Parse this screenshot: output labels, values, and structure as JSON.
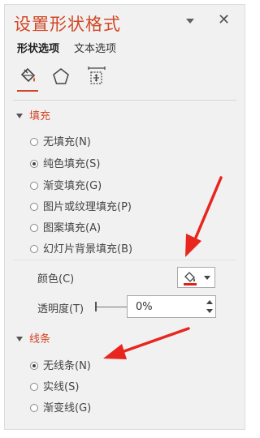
{
  "pane": {
    "title": "设置形状格式",
    "tabs": [
      {
        "label": "形状选项",
        "selected": true
      },
      {
        "label": "文本选项",
        "selected": false
      }
    ],
    "categories": [
      {
        "icon": "paint-bucket-icon",
        "selected": true
      },
      {
        "icon": "pentagon-icon",
        "selected": false
      },
      {
        "icon": "size-properties-icon",
        "selected": false
      }
    ]
  },
  "fill": {
    "header": "填充",
    "options": [
      {
        "label": "无填充(N)",
        "selected": false
      },
      {
        "label": "纯色填充(S)",
        "selected": true
      },
      {
        "label": "渐变填充(G)",
        "selected": false
      },
      {
        "label": "图片或纹理填充(P)",
        "selected": false
      },
      {
        "label": "图案填充(A)",
        "selected": false
      },
      {
        "label": "幻灯片背景填充(B)",
        "selected": false
      }
    ],
    "color_label": "颜色(C)",
    "color_value": "#e0221a",
    "transparency_label": "透明度(T)",
    "transparency_value": "0%",
    "transparency_fraction": 0
  },
  "line": {
    "header": "线条",
    "options": [
      {
        "label": "无线条(N)",
        "selected": true
      },
      {
        "label": "实线(S)",
        "selected": false
      },
      {
        "label": "渐变线(G)",
        "selected": false
      }
    ]
  },
  "colors": {
    "accent": "#d24726",
    "annotation_arrow": "#e8261f",
    "panel_bg": "#f1f1f1"
  }
}
